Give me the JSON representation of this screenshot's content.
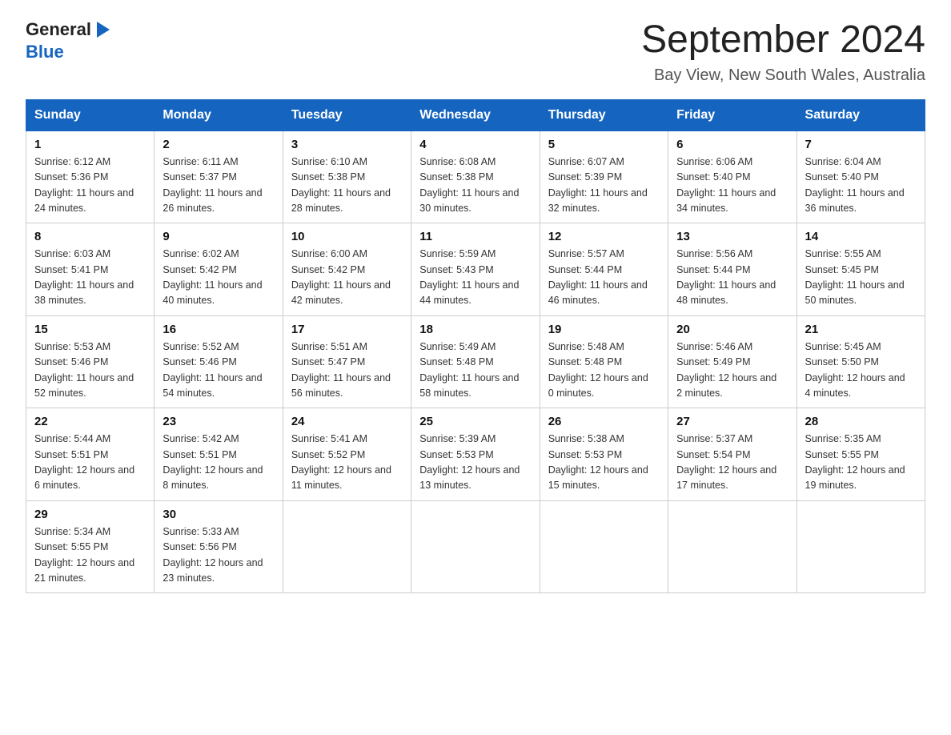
{
  "header": {
    "logo_general": "General",
    "logo_blue": "Blue",
    "title": "September 2024",
    "subtitle": "Bay View, New South Wales, Australia"
  },
  "days_of_week": [
    "Sunday",
    "Monday",
    "Tuesday",
    "Wednesday",
    "Thursday",
    "Friday",
    "Saturday"
  ],
  "weeks": [
    [
      {
        "num": "1",
        "sunrise": "6:12 AM",
        "sunset": "5:36 PM",
        "daylight": "11 hours and 24 minutes."
      },
      {
        "num": "2",
        "sunrise": "6:11 AM",
        "sunset": "5:37 PM",
        "daylight": "11 hours and 26 minutes."
      },
      {
        "num": "3",
        "sunrise": "6:10 AM",
        "sunset": "5:38 PM",
        "daylight": "11 hours and 28 minutes."
      },
      {
        "num": "4",
        "sunrise": "6:08 AM",
        "sunset": "5:38 PM",
        "daylight": "11 hours and 30 minutes."
      },
      {
        "num": "5",
        "sunrise": "6:07 AM",
        "sunset": "5:39 PM",
        "daylight": "11 hours and 32 minutes."
      },
      {
        "num": "6",
        "sunrise": "6:06 AM",
        "sunset": "5:40 PM",
        "daylight": "11 hours and 34 minutes."
      },
      {
        "num": "7",
        "sunrise": "6:04 AM",
        "sunset": "5:40 PM",
        "daylight": "11 hours and 36 minutes."
      }
    ],
    [
      {
        "num": "8",
        "sunrise": "6:03 AM",
        "sunset": "5:41 PM",
        "daylight": "11 hours and 38 minutes."
      },
      {
        "num": "9",
        "sunrise": "6:02 AM",
        "sunset": "5:42 PM",
        "daylight": "11 hours and 40 minutes."
      },
      {
        "num": "10",
        "sunrise": "6:00 AM",
        "sunset": "5:42 PM",
        "daylight": "11 hours and 42 minutes."
      },
      {
        "num": "11",
        "sunrise": "5:59 AM",
        "sunset": "5:43 PM",
        "daylight": "11 hours and 44 minutes."
      },
      {
        "num": "12",
        "sunrise": "5:57 AM",
        "sunset": "5:44 PM",
        "daylight": "11 hours and 46 minutes."
      },
      {
        "num": "13",
        "sunrise": "5:56 AM",
        "sunset": "5:44 PM",
        "daylight": "11 hours and 48 minutes."
      },
      {
        "num": "14",
        "sunrise": "5:55 AM",
        "sunset": "5:45 PM",
        "daylight": "11 hours and 50 minutes."
      }
    ],
    [
      {
        "num": "15",
        "sunrise": "5:53 AM",
        "sunset": "5:46 PM",
        "daylight": "11 hours and 52 minutes."
      },
      {
        "num": "16",
        "sunrise": "5:52 AM",
        "sunset": "5:46 PM",
        "daylight": "11 hours and 54 minutes."
      },
      {
        "num": "17",
        "sunrise": "5:51 AM",
        "sunset": "5:47 PM",
        "daylight": "11 hours and 56 minutes."
      },
      {
        "num": "18",
        "sunrise": "5:49 AM",
        "sunset": "5:48 PM",
        "daylight": "11 hours and 58 minutes."
      },
      {
        "num": "19",
        "sunrise": "5:48 AM",
        "sunset": "5:48 PM",
        "daylight": "12 hours and 0 minutes."
      },
      {
        "num": "20",
        "sunrise": "5:46 AM",
        "sunset": "5:49 PM",
        "daylight": "12 hours and 2 minutes."
      },
      {
        "num": "21",
        "sunrise": "5:45 AM",
        "sunset": "5:50 PM",
        "daylight": "12 hours and 4 minutes."
      }
    ],
    [
      {
        "num": "22",
        "sunrise": "5:44 AM",
        "sunset": "5:51 PM",
        "daylight": "12 hours and 6 minutes."
      },
      {
        "num": "23",
        "sunrise": "5:42 AM",
        "sunset": "5:51 PM",
        "daylight": "12 hours and 8 minutes."
      },
      {
        "num": "24",
        "sunrise": "5:41 AM",
        "sunset": "5:52 PM",
        "daylight": "12 hours and 11 minutes."
      },
      {
        "num": "25",
        "sunrise": "5:39 AM",
        "sunset": "5:53 PM",
        "daylight": "12 hours and 13 minutes."
      },
      {
        "num": "26",
        "sunrise": "5:38 AM",
        "sunset": "5:53 PM",
        "daylight": "12 hours and 15 minutes."
      },
      {
        "num": "27",
        "sunrise": "5:37 AM",
        "sunset": "5:54 PM",
        "daylight": "12 hours and 17 minutes."
      },
      {
        "num": "28",
        "sunrise": "5:35 AM",
        "sunset": "5:55 PM",
        "daylight": "12 hours and 19 minutes."
      }
    ],
    [
      {
        "num": "29",
        "sunrise": "5:34 AM",
        "sunset": "5:55 PM",
        "daylight": "12 hours and 21 minutes."
      },
      {
        "num": "30",
        "sunrise": "5:33 AM",
        "sunset": "5:56 PM",
        "daylight": "12 hours and 23 minutes."
      },
      null,
      null,
      null,
      null,
      null
    ]
  ],
  "labels": {
    "sunrise": "Sunrise:",
    "sunset": "Sunset:",
    "daylight": "Daylight:"
  }
}
